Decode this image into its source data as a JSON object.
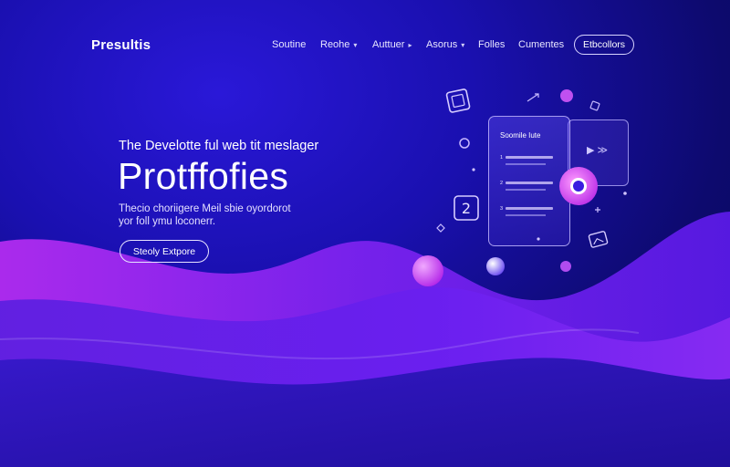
{
  "brand": "Presultis",
  "nav": {
    "links": [
      {
        "label": "Soutine",
        "has_dropdown": false
      },
      {
        "label": "Reohe",
        "has_dropdown": true
      },
      {
        "label": "Auttuer",
        "has_dropdown": true
      },
      {
        "label": "Asorus",
        "has_dropdown": true
      },
      {
        "label": "Folles",
        "has_dropdown": false
      },
      {
        "label": "Cumentes",
        "has_dropdown": false
      }
    ],
    "cta": "Etbcollors"
  },
  "hero": {
    "subtitle": "The Develotte ful web tit meslager",
    "title": "Protffofies",
    "desc_line1": "Thecio choriigere Meil sbie oyordorot",
    "desc_line2": "yor foll ymu loconerr.",
    "button": "Steoly Extpore"
  },
  "illustration": {
    "card_title": "Soomile Iute",
    "rows": [
      "1",
      "2",
      "3"
    ],
    "badge": "2"
  },
  "colors": {
    "background": "#1a10b0",
    "wave_light": "#a020f0",
    "wave_dark": "#5a18e0",
    "accent_orb": "#c04cf0"
  }
}
